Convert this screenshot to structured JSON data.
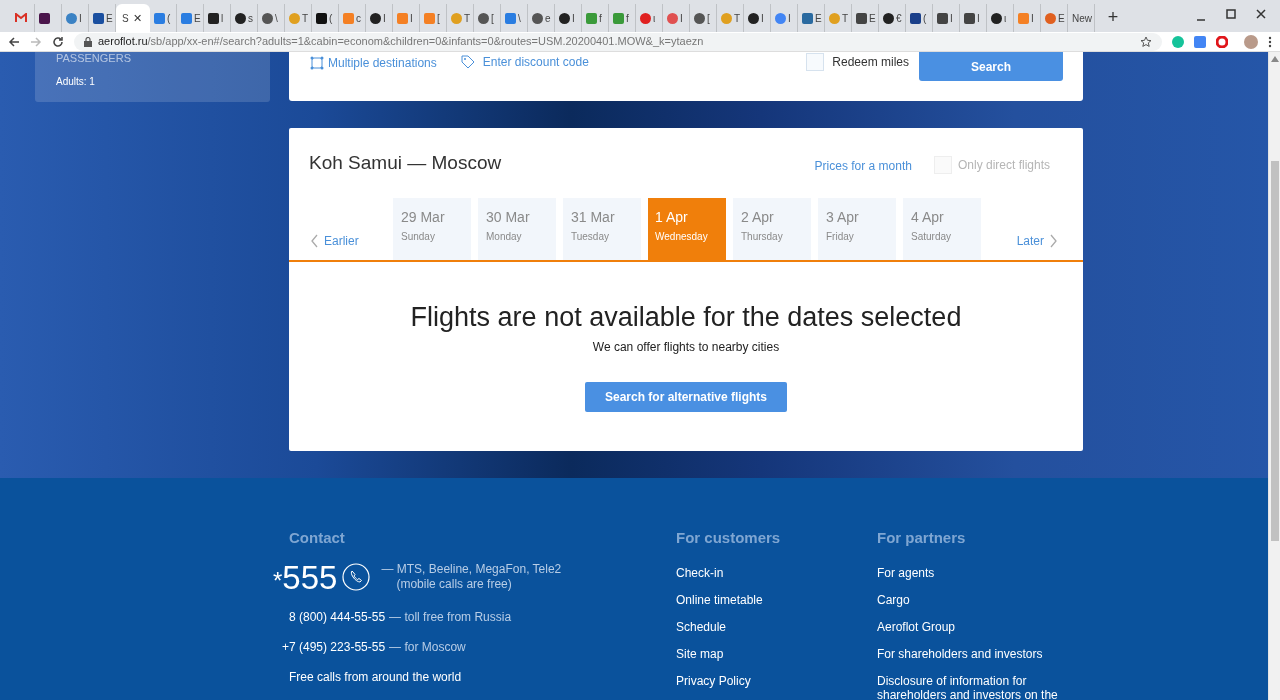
{
  "browser": {
    "tabs": [
      {
        "kind": "letter-m",
        "color": "#d93025",
        "selected": false
      },
      {
        "kind": "square",
        "color": "#4a154b",
        "selected": false
      },
      {
        "title": "I",
        "kind": "circle",
        "color": "#3b82c4",
        "selected": false
      },
      {
        "title": "E",
        "kind": "square",
        "color": "#1a4fa0",
        "selected": false
      },
      {
        "title": "S",
        "kind": "none",
        "selected": true
      },
      {
        "title": "(",
        "kind": "square",
        "color": "#2a7de1",
        "selected": false
      },
      {
        "title": "E",
        "kind": "square",
        "color": "#2a7de1",
        "selected": false
      },
      {
        "title": "l",
        "kind": "square",
        "color": "#222222",
        "selected": false
      },
      {
        "title": "s",
        "kind": "circle",
        "color": "#222222",
        "selected": false
      },
      {
        "title": "\\",
        "kind": "circle",
        "color": "#555555",
        "selected": false
      },
      {
        "title": "T",
        "kind": "circle",
        "color": "#e0a020",
        "selected": false
      },
      {
        "title": "(",
        "kind": "square",
        "color": "#111111",
        "selected": false
      },
      {
        "title": "c",
        "kind": "square",
        "color": "#f48024",
        "selected": false
      },
      {
        "title": "I",
        "kind": "circle",
        "color": "#222222",
        "selected": false
      },
      {
        "title": "I",
        "kind": "square",
        "color": "#f48024",
        "selected": false
      },
      {
        "title": "[",
        "kind": "square",
        "color": "#f48024",
        "selected": false
      },
      {
        "title": "T",
        "kind": "circle",
        "color": "#e0a020",
        "selected": false
      },
      {
        "title": "[",
        "kind": "circle",
        "color": "#555555",
        "selected": false
      },
      {
        "title": "\\",
        "kind": "square",
        "color": "#2a7de1",
        "selected": false
      },
      {
        "title": "e",
        "kind": "circle",
        "color": "#555555",
        "selected": false
      },
      {
        "title": "I",
        "kind": "circle",
        "color": "#222222",
        "selected": false
      },
      {
        "title": "f",
        "kind": "square",
        "color": "#3a9a3a",
        "selected": false
      },
      {
        "title": "f",
        "kind": "square",
        "color": "#3a9a3a",
        "selected": false
      },
      {
        "title": "ι",
        "kind": "circle",
        "color": "#e02020",
        "selected": false
      },
      {
        "title": "I",
        "kind": "circle",
        "color": "#e05050",
        "selected": false
      },
      {
        "title": "[",
        "kind": "circle",
        "color": "#555555",
        "selected": false
      },
      {
        "title": "T",
        "kind": "circle",
        "color": "#e0a020",
        "selected": false
      },
      {
        "title": "I",
        "kind": "circle",
        "color": "#222222",
        "selected": false
      },
      {
        "title": "I",
        "kind": "circle",
        "color": "#4285f4",
        "selected": false
      },
      {
        "title": "E",
        "kind": "square",
        "color": "#2a6aa0",
        "selected": false
      },
      {
        "title": "T",
        "kind": "circle",
        "color": "#e0a020",
        "selected": false
      },
      {
        "title": "E",
        "kind": "square",
        "color": "#444444",
        "selected": false
      },
      {
        "title": "€",
        "kind": "circle",
        "color": "#222222",
        "selected": false
      },
      {
        "title": "(",
        "kind": "square",
        "color": "#1a3f8a",
        "selected": false
      },
      {
        "title": "I",
        "kind": "square",
        "color": "#444444",
        "selected": false
      },
      {
        "title": "I",
        "kind": "square",
        "color": "#444444",
        "selected": false
      },
      {
        "title": "ι",
        "kind": "circle",
        "color": "#222222",
        "selected": false
      },
      {
        "title": "I",
        "kind": "square",
        "color": "#f48024",
        "selected": false
      },
      {
        "title": "E",
        "kind": "circle",
        "color": "#e06020",
        "selected": false
      },
      {
        "title": "New",
        "kind": "none",
        "selected": false
      }
    ],
    "close_tab": "✕",
    "new_tab": "+",
    "url_host": "aeroflot.ru",
    "url_path": "/sb/app/xx-en#/search?adults=1&cabin=econom&children=0&infants=0&routes=USM.20200401.MOW&_k=ytaezn"
  },
  "passengers_panel": {
    "heading": "PASSENGERS",
    "adults": "Adults: 1"
  },
  "search_form": {
    "multiple_destinations": "Multiple destinations",
    "discount_code": "Enter discount code",
    "redeem_miles": {
      "label": "Redeem miles",
      "checked": false
    },
    "search_button": "Search"
  },
  "results": {
    "route": "Koh Samui — Moscow",
    "prices_for_month": "Prices for a month",
    "direct_only": {
      "label": "Only direct flights",
      "checked": false,
      "disabled": true
    },
    "earlier": "Earlier",
    "later": "Later",
    "dates": [
      {
        "date": "29 Mar",
        "weekday": "Sunday",
        "selected": false
      },
      {
        "date": "30 Mar",
        "weekday": "Monday",
        "selected": false
      },
      {
        "date": "31 Mar",
        "weekday": "Tuesday",
        "selected": false
      },
      {
        "date": "1 Apr",
        "weekday": "Wednesday",
        "selected": true
      },
      {
        "date": "2 Apr",
        "weekday": "Thursday",
        "selected": false
      },
      {
        "date": "3 Apr",
        "weekday": "Friday",
        "selected": false
      },
      {
        "date": "4 Apr",
        "weekday": "Saturday",
        "selected": false
      }
    ],
    "message": "Flights are not available for the dates selected",
    "submessage": "We can offer flights to nearby cities",
    "alt_button": "Search for alternative flights"
  },
  "footer": {
    "contact": {
      "heading": "Contact",
      "star": "*",
      "short_number": "555",
      "short_note": "— MTS, Beeline, MegaFon, Tele2",
      "short_note2": "(mobile calls are free)",
      "phones": [
        {
          "number": "8 (800) 444-55-55",
          "note": "— toll free from Russia"
        },
        {
          "number": "+7 (495) 223-55-55",
          "note": "— for Moscow"
        }
      ],
      "world": "Free calls from around the world"
    },
    "columns": [
      {
        "heading": "For customers",
        "links": [
          "Check-in",
          "Online timetable",
          "Schedule",
          "Site map",
          "Privacy Policy"
        ]
      },
      {
        "heading": "For partners",
        "links": [
          "For agents",
          "Cargo",
          "Aeroflot Group",
          "For shareholders and investors",
          "Disclosure of information for shareholders and investors on the"
        ]
      }
    ]
  }
}
